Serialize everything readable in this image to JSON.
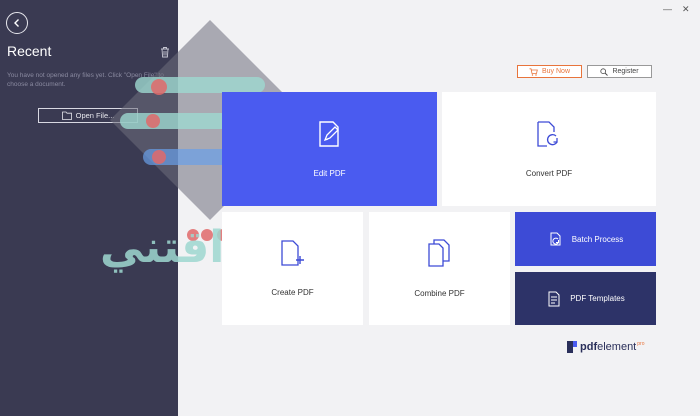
{
  "sidebar": {
    "title": "Recent",
    "empty_message": "You have not opened any files yet. Click \"Open File\" to choose a document.",
    "open_file_label": "Open File..."
  },
  "window_controls": {
    "minimize": "—",
    "close": "✕"
  },
  "header": {
    "buy_label": "Buy Now",
    "register_label": "Register"
  },
  "tiles": {
    "edit": "Edit PDF",
    "convert": "Convert PDF",
    "create": "Create PDF",
    "combine": "Combine PDF",
    "batch": "Batch Process",
    "templates": "PDF Templates"
  },
  "brand": {
    "pdf": "pdf",
    "element": "element",
    "pro": "pro"
  },
  "colors": {
    "sidebar": "#3a3a52",
    "accent": "#4a5bf0",
    "dark_tile": "#2d3368",
    "buy": "#e8743b"
  },
  "watermark": {
    "text": "اقتني"
  }
}
